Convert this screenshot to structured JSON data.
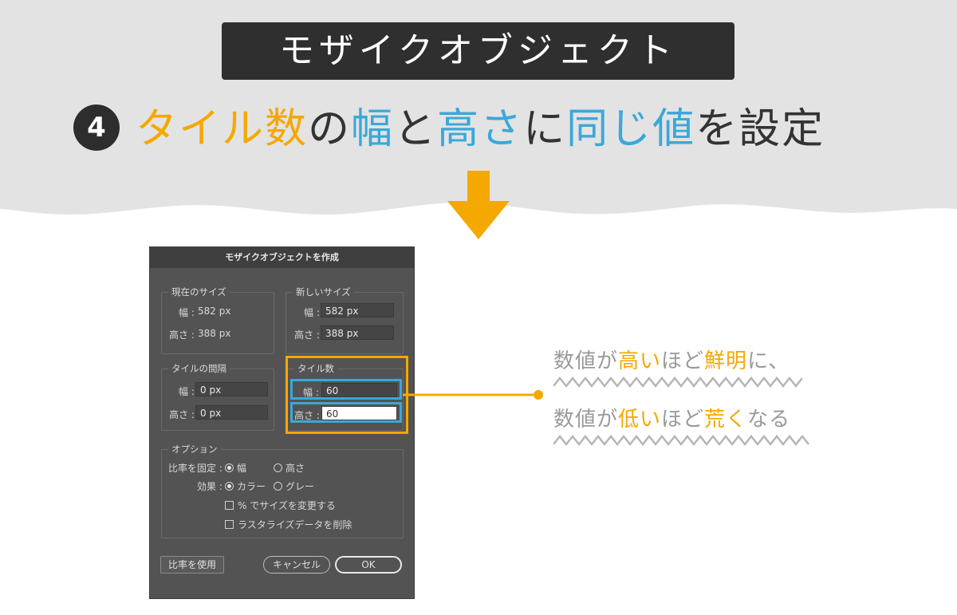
{
  "page": {
    "title": "モザイクオブジェクト",
    "step_number": "4",
    "subtitle_parts": [
      {
        "text": "タイル数",
        "color": "orange"
      },
      {
        "text": "の",
        "color": "dark"
      },
      {
        "text": "幅",
        "color": "blue"
      },
      {
        "text": "と",
        "color": "dark"
      },
      {
        "text": "高さ",
        "color": "blue"
      },
      {
        "text": "に",
        "color": "dark"
      },
      {
        "text": "同じ値",
        "color": "blue"
      },
      {
        "text": "を設定",
        "color": "dark"
      }
    ]
  },
  "dialog": {
    "title": "モザイクオブジェクトを作成",
    "current_size": {
      "label": "現在のサイズ",
      "width_label": "幅 :",
      "width_value": "582 px",
      "height_label": "高さ :",
      "height_value": "388 px"
    },
    "new_size": {
      "label": "新しいサイズ",
      "width_label": "幅 :",
      "width_value": "582 px",
      "height_label": "高さ :",
      "height_value": "388 px"
    },
    "tile_spacing": {
      "label": "タイルの間隔",
      "width_label": "幅 :",
      "width_value": "0 px",
      "height_label": "高さ :",
      "height_value": "0 px"
    },
    "tile_count": {
      "label": "タイル数",
      "width_label": "幅 :",
      "width_value": "60",
      "height_label": "高さ :",
      "height_value": "60"
    },
    "options": {
      "label": "オプション",
      "constrain_label": "比率を固定 :",
      "constrain_width": "幅",
      "constrain_height": "高さ",
      "effect_label": "効果 :",
      "effect_color": "カラー",
      "effect_gray": "グレー",
      "resize_percent": "% でサイズを変更する",
      "delete_raster": "ラスタライズデータを削除"
    },
    "buttons": {
      "use_ratio": "比率を使用",
      "cancel": "キャンセル",
      "ok": "OK"
    }
  },
  "callout": {
    "line1_parts": [
      {
        "text": "数値が",
        "color": "gray"
      },
      {
        "text": "高い",
        "color": "orange"
      },
      {
        "text": "ほど",
        "color": "gray"
      },
      {
        "text": "鮮明",
        "color": "orange"
      },
      {
        "text": "に、",
        "color": "gray"
      }
    ],
    "line2_parts": [
      {
        "text": "数値が",
        "color": "gray"
      },
      {
        "text": "低い",
        "color": "orange"
      },
      {
        "text": "ほど",
        "color": "gray"
      },
      {
        "text": "荒く",
        "color": "orange"
      },
      {
        "text": "なる",
        "color": "gray"
      }
    ]
  },
  "colors": {
    "orange": "#f5a800",
    "blue": "#3aa8d9",
    "dark": "#333333",
    "gray": "#9a9a9a",
    "header_bg": "#e3e3e3"
  }
}
